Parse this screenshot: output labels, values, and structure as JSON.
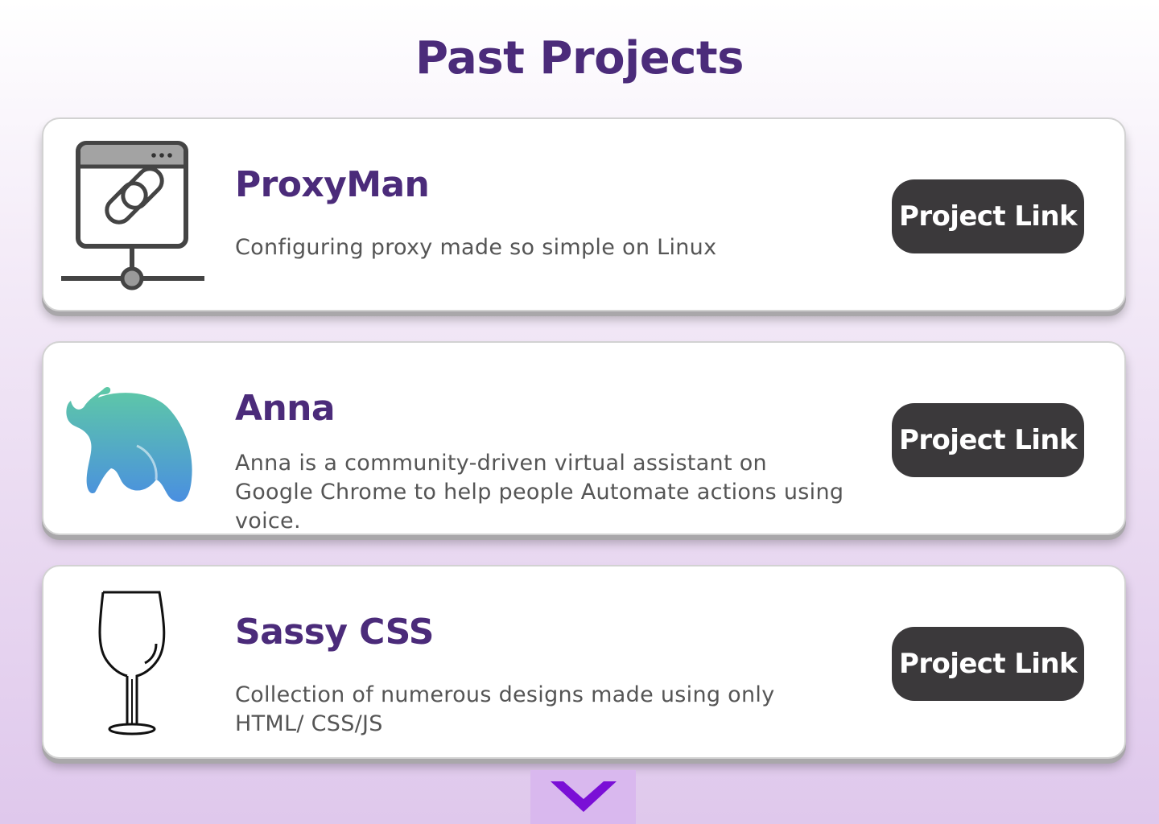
{
  "header": {
    "title": "Past Projects"
  },
  "projects": [
    {
      "icon": "network-link-icon",
      "title": "ProxyMan",
      "description": "Configuring proxy made so simple on Linux",
      "button_label": "Project Link"
    },
    {
      "icon": "elephant-icon",
      "title": "Anna",
      "description": "Anna is a community-driven virtual assistant on Google Chrome to help people Automate actions using voice.",
      "button_label": "Project Link"
    },
    {
      "icon": "wine-glass-icon",
      "title": "Sassy CSS",
      "description": "Collection of numerous designs made using only HTML/ CSS/JS",
      "button_label": "Project Link"
    }
  ],
  "scroll": {
    "icon": "chevron-down-icon"
  },
  "colors": {
    "title": "#4b2b7a",
    "button_bg": "#3b393b",
    "chevron": "#7a0fd6",
    "elephant_top": "#5ec9a6",
    "elephant_bottom": "#4a8fe0"
  }
}
